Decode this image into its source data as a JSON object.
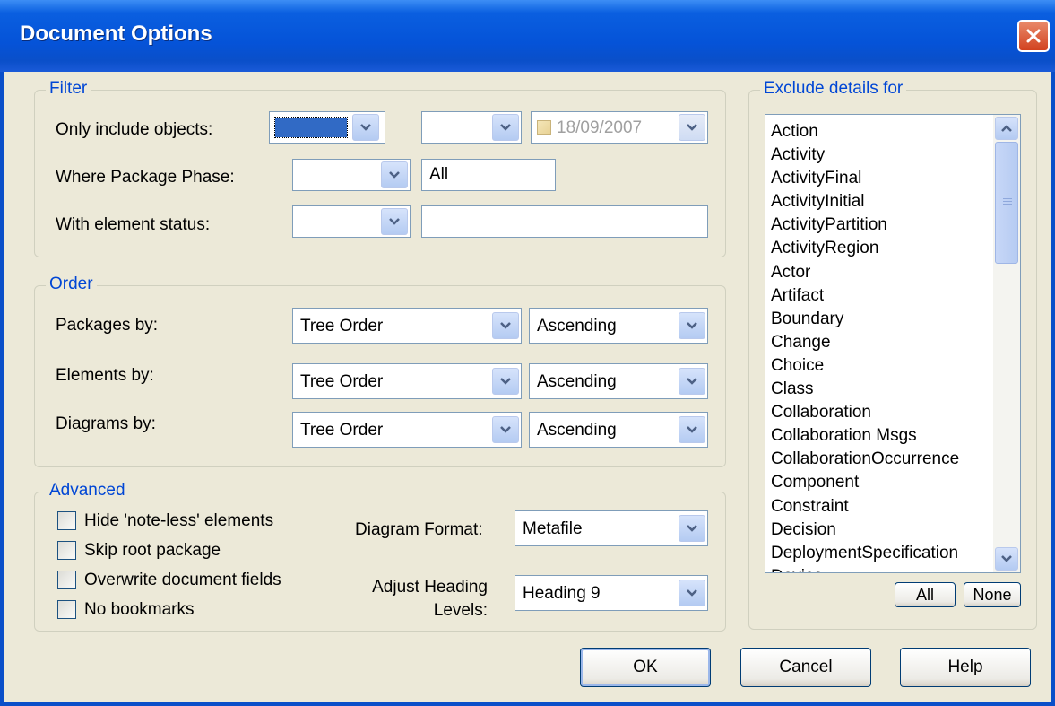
{
  "window": {
    "title": "Document Options"
  },
  "filter": {
    "legend": "Filter",
    "only_include_label": "Only include objects:",
    "only_include_value": "",
    "only_include_op": "",
    "date_value": "18/09/2007",
    "phase_label": "Where Package Phase:",
    "phase_op": "",
    "phase_value": "All",
    "status_label": "With element status:",
    "status_op": "",
    "status_value": ""
  },
  "order": {
    "legend": "Order",
    "rows": [
      {
        "label": "Packages by:",
        "order": "Tree Order",
        "direction": "Ascending"
      },
      {
        "label": "Elements by:",
        "order": "Tree Order",
        "direction": "Ascending"
      },
      {
        "label": "Diagrams by:",
        "order": "Tree Order",
        "direction": "Ascending"
      }
    ]
  },
  "advanced": {
    "legend": "Advanced",
    "checkboxes": [
      {
        "label": "Hide 'note-less' elements",
        "checked": false
      },
      {
        "label": "Skip root package",
        "checked": false
      },
      {
        "label": "Overwrite document fields",
        "checked": false
      },
      {
        "label": "No bookmarks",
        "checked": false
      }
    ],
    "diagram_format_label": "Diagram Format:",
    "diagram_format_value": "Metafile",
    "heading_label_line1": "Adjust Heading",
    "heading_label_line2": "Levels:",
    "heading_value": "Heading 9"
  },
  "exclude": {
    "legend": "Exclude details for",
    "items": [
      "Action",
      "Activity",
      "ActivityFinal",
      "ActivityInitial",
      "ActivityPartition",
      "ActivityRegion",
      "Actor",
      "Artifact",
      "Boundary",
      "Change",
      "Choice",
      "Class",
      "Collaboration",
      "Collaboration Msgs",
      "CollaborationOccurrence",
      "Component",
      "Constraint",
      "Decision",
      "DeploymentSpecification",
      "Device"
    ],
    "all_label": "All",
    "none_label": "None"
  },
  "buttons": {
    "ok": "OK",
    "cancel": "Cancel",
    "help": "Help"
  },
  "colors": {
    "titlebar": "#0553d8",
    "dialog_bg": "#ece9d8",
    "legend_text": "#0046d5",
    "selection": "#316ac5"
  }
}
